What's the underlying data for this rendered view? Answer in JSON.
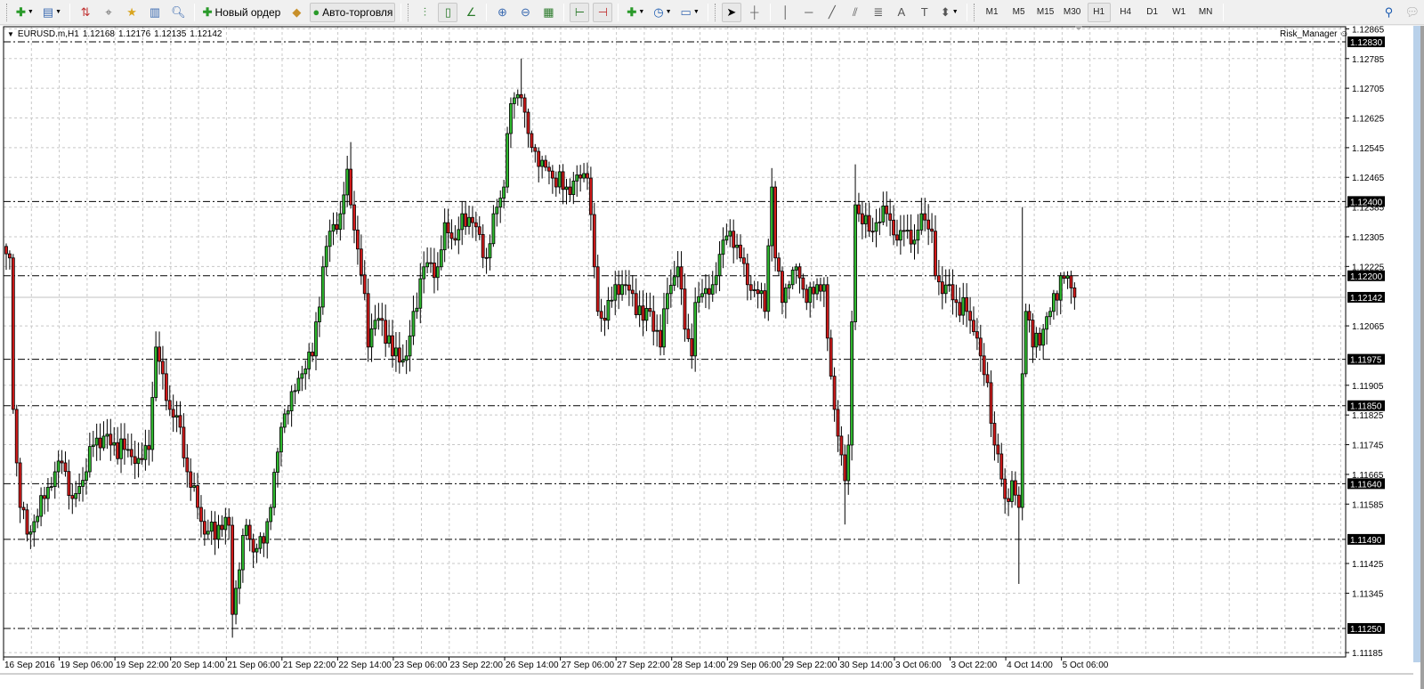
{
  "toolbar": {
    "new_order": "Новый ордер",
    "auto_trading": "Авто-торговля",
    "timeframes": [
      "M1",
      "M5",
      "M15",
      "M30",
      "H1",
      "H4",
      "D1",
      "W1",
      "MN"
    ],
    "active_timeframe": "H1",
    "icons": [
      "new-chart-icon",
      "profiles-icon",
      "market-watch-icon",
      "navigator-crosshair-icon",
      "favorites-icon",
      "data-window-icon",
      "strategy-tester-icon",
      "new-order-icon",
      "metaeditor-icon",
      "auto-trading-icon",
      "bar-chart-icon",
      "candlestick-icon",
      "line-chart-icon",
      "zoom-in-icon",
      "zoom-out-icon",
      "tile-windows-icon",
      "chart-shift-icon",
      "autoscroll-icon",
      "indicators-icon",
      "periods-icon",
      "templates-icon",
      "cursor-icon",
      "crosshair-icon",
      "vertical-line-icon",
      "horizontal-line-icon",
      "trendline-icon",
      "equidistant-channel-icon",
      "fibonacci-icon",
      "text-icon",
      "text-label-icon",
      "arrows-icon",
      "search-icon",
      "chat-icon"
    ]
  },
  "chart": {
    "symbol_info": "EURUSD.m,H1",
    "ohlc": [
      "1.12168",
      "1.12176",
      "1.12135",
      "1.12142"
    ],
    "expert_name": "Risk_Manager",
    "expert_icon": "smiley-icon"
  },
  "chart_data": {
    "type": "candlestick",
    "symbol": "EURUSD.m",
    "timeframe": "H1",
    "ylim": [
      1.11185,
      1.12865
    ],
    "grid": true,
    "colors": {
      "bull": "#2eb82e",
      "bear": "#d11a1a",
      "outline": "#000000",
      "bid_line": "#c0c0c0"
    },
    "close_waypoints": [
      [
        0,
        1.12259
      ],
      [
        1,
        1.12248
      ],
      [
        2,
        1.1184
      ],
      [
        3,
        1.11696
      ],
      [
        4,
        1.11576
      ],
      [
        6,
        1.11504
      ],
      [
        9,
        1.11552
      ],
      [
        11,
        1.116
      ],
      [
        14,
        1.11672
      ],
      [
        16,
        1.11696
      ],
      [
        19,
        1.116
      ],
      [
        23,
        1.11672
      ],
      [
        25,
        1.11744
      ],
      [
        28,
        1.11768
      ],
      [
        30,
        1.11744
      ],
      [
        34,
        1.11732
      ],
      [
        38,
        1.11708
      ],
      [
        41,
        1.11732
      ],
      [
        43,
        1.12008
      ],
      [
        45,
        1.11936
      ],
      [
        46,
        1.11864
      ],
      [
        47,
        1.1184
      ],
      [
        50,
        1.11792
      ],
      [
        52,
        1.11672
      ],
      [
        55,
        1.11576
      ],
      [
        57,
        1.11504
      ],
      [
        61,
        1.11528
      ],
      [
        64,
        1.11528
      ],
      [
        65,
        1.11288
      ],
      [
        67,
        1.11408
      ],
      [
        69,
        1.11528
      ],
      [
        71,
        1.11456
      ],
      [
        74,
        1.1148
      ],
      [
        76,
        1.11576
      ],
      [
        79,
        1.11792
      ],
      [
        82,
        1.11888
      ],
      [
        85,
        1.11936
      ],
      [
        88,
        1.11984
      ],
      [
        91,
        1.12224
      ],
      [
        93,
        1.1232
      ],
      [
        96,
        1.12367
      ],
      [
        98,
        1.12487
      ],
      [
        99,
        1.12391
      ],
      [
        101,
        1.12272
      ],
      [
        103,
        1.12152
      ],
      [
        104,
        1.12008
      ],
      [
        106,
        1.1208
      ],
      [
        108,
        1.1208
      ],
      [
        111,
        1.11984
      ],
      [
        115,
        1.11984
      ],
      [
        117,
        1.12104
      ],
      [
        120,
        1.12224
      ],
      [
        124,
        1.12224
      ],
      [
        126,
        1.12343
      ],
      [
        129,
        1.12296
      ],
      [
        131,
        1.12367
      ],
      [
        134,
        1.12343
      ],
      [
        138,
        1.12248
      ],
      [
        140,
        1.12367
      ],
      [
        143,
        1.12439
      ],
      [
        144,
        1.12583
      ],
      [
        146,
        1.12679
      ],
      [
        148,
        1.12679
      ],
      [
        150,
        1.12583
      ],
      [
        152,
        1.12535
      ],
      [
        154,
        1.12511
      ],
      [
        157,
        1.12463
      ],
      [
        161,
        1.12439
      ],
      [
        165,
        1.12463
      ],
      [
        167,
        1.12463
      ],
      [
        169,
        1.12224
      ],
      [
        170,
        1.12104
      ],
      [
        172,
        1.1208
      ],
      [
        175,
        1.12176
      ],
      [
        177,
        1.12176
      ],
      [
        180,
        1.12152
      ],
      [
        183,
        1.1208
      ],
      [
        185,
        1.12104
      ],
      [
        188,
        1.12008
      ],
      [
        190,
        1.12152
      ],
      [
        193,
        1.12224
      ],
      [
        195,
        1.12056
      ],
      [
        197,
        1.11984
      ],
      [
        198,
        1.12128
      ],
      [
        200,
        1.12152
      ],
      [
        203,
        1.12176
      ],
      [
        206,
        1.12296
      ],
      [
        208,
        1.1232
      ],
      [
        211,
        1.12248
      ],
      [
        213,
        1.12176
      ],
      [
        216,
        1.12152
      ],
      [
        218,
        1.12104
      ],
      [
        220,
        1.12439
      ],
      [
        221,
        1.12248
      ],
      [
        223,
        1.12128
      ],
      [
        225,
        1.12176
      ],
      [
        227,
        1.12224
      ],
      [
        230,
        1.12128
      ],
      [
        233,
        1.12176
      ],
      [
        235,
        1.12176
      ],
      [
        236,
        1.12032
      ],
      [
        238,
        1.1184
      ],
      [
        239,
        1.11768
      ],
      [
        241,
        1.11648
      ],
      [
        242,
        1.11744
      ],
      [
        244,
        1.12391
      ],
      [
        245,
        1.12367
      ],
      [
        248,
        1.1232
      ],
      [
        250,
        1.12343
      ],
      [
        253,
        1.12367
      ],
      [
        256,
        1.12296
      ],
      [
        258,
        1.1232
      ],
      [
        261,
        1.12296
      ],
      [
        263,
        1.12367
      ],
      [
        266,
        1.1232
      ],
      [
        267,
        1.122
      ],
      [
        269,
        1.12152
      ],
      [
        271,
        1.12176
      ],
      [
        273,
        1.12128
      ],
      [
        276,
        1.12104
      ],
      [
        279,
        1.12032
      ],
      [
        280,
        1.11984
      ],
      [
        282,
        1.11912
      ],
      [
        284,
        1.11744
      ],
      [
        285,
        1.1172
      ],
      [
        287,
        1.116
      ],
      [
        289,
        1.11648
      ],
      [
        291,
        1.11576
      ],
      [
        292,
        1.11936
      ],
      [
        293,
        1.12104
      ],
      [
        295,
        1.12008
      ],
      [
        298,
        1.12056
      ],
      [
        300,
        1.12104
      ],
      [
        303,
        1.122
      ],
      [
        305,
        1.122
      ],
      [
        307,
        1.12142
      ]
    ],
    "extreme_wicks": [
      [
        148,
        "high",
        1.12785
      ],
      [
        99,
        "high",
        1.1256
      ],
      [
        65,
        "low",
        1.11225
      ],
      [
        291,
        "low",
        1.1137
      ],
      [
        292,
        "high",
        1.12385
      ],
      [
        241,
        "low",
        1.1153
      ],
      [
        244,
        "high",
        1.125
      ],
      [
        220,
        "high",
        1.1249
      ]
    ],
    "price_ticks": [
      "1.12865",
      "1.12785",
      "1.12705",
      "1.12625",
      "1.12545",
      "1.12465",
      "1.12385",
      "1.12305",
      "1.12225",
      "1.12065",
      "1.11905",
      "1.11825",
      "1.11745",
      "1.11665",
      "1.11585",
      "1.11425",
      "1.11345",
      "1.11185"
    ],
    "level_lines": [
      "1.12830",
      "1.12400",
      "1.12200",
      "1.11975",
      "1.11850",
      "1.11640",
      "1.11490",
      "1.11250"
    ],
    "bid": "1.12142",
    "time_labels": [
      "16 Sep 2016",
      "19 Sep 06:00",
      "19 Sep 22:00",
      "20 Sep 14:00",
      "21 Sep 06:00",
      "21 Sep 22:00",
      "22 Sep 14:00",
      "23 Sep 06:00",
      "23 Sep 22:00",
      "26 Sep 14:00",
      "27 Sep 06:00",
      "27 Sep 22:00",
      "28 Sep 14:00",
      "29 Sep 06:00",
      "29 Sep 22:00",
      "30 Sep 14:00",
      "3 Oct 06:00",
      "3 Oct 22:00",
      "4 Oct 14:00",
      "5 Oct 06:00"
    ],
    "bars_per_time_label": 16
  }
}
